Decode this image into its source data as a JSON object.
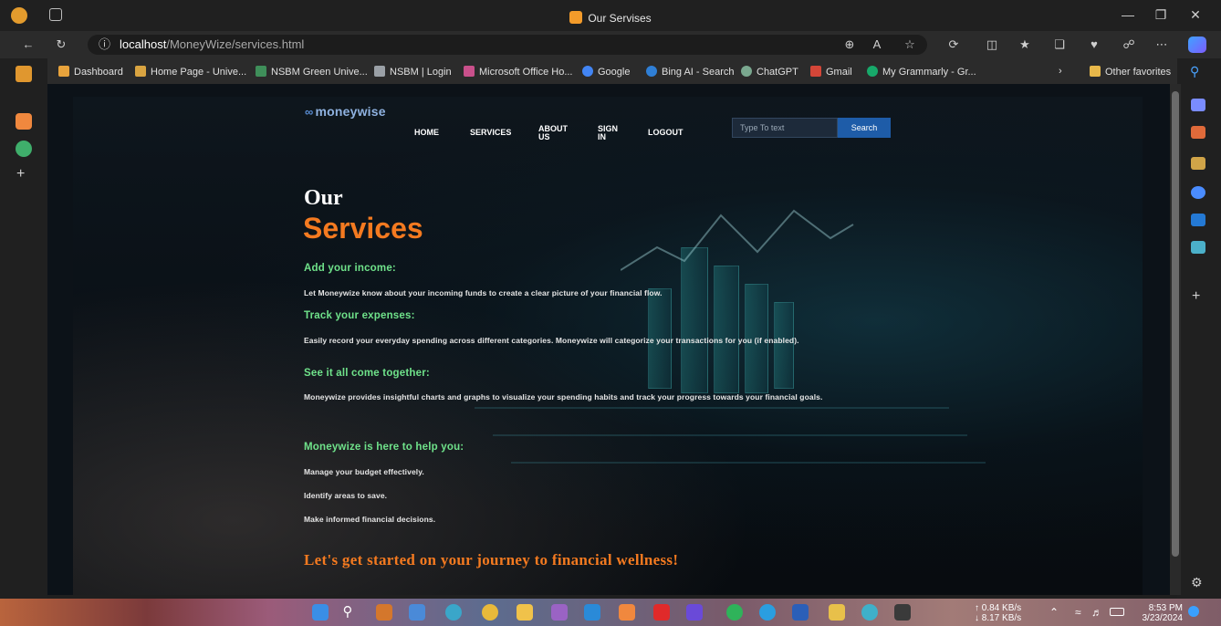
{
  "browser": {
    "tab_title": "Our Servises",
    "url_host": "localhost",
    "url_path": "/MoneyWize/services.html",
    "favorites": [
      {
        "label": "Dashboard",
        "color": "#e8a33c"
      },
      {
        "label": "Home Page - Unive...",
        "color": "#d9a441"
      },
      {
        "label": "NSBM Green Unive...",
        "color": "#3f8f5a"
      },
      {
        "label": "NSBM | Login",
        "color": "#9aa0a6"
      },
      {
        "label": "Microsoft Office Ho...",
        "color": "#c9508b"
      },
      {
        "label": "Google",
        "color": "#4285f4"
      },
      {
        "label": "Bing AI - Search",
        "color": "#2f7fd6"
      },
      {
        "label": "ChatGPT",
        "color": "#7aa88f"
      },
      {
        "label": "Gmail",
        "color": "#d44638"
      },
      {
        "label": "My Grammarly - Gr...",
        "color": "#17a96a"
      }
    ],
    "other_favorites": "Other favorites"
  },
  "site": {
    "logo_mark": "∞",
    "logo_text": "moneywise",
    "nav": {
      "home": "HOME",
      "services": "SERVICES",
      "about": "ABOUT US",
      "signin": "SIGN IN",
      "logout": "LOGOUT"
    },
    "search": {
      "placeholder": "Type To text",
      "button": "Search"
    }
  },
  "content": {
    "heading_small": "Our",
    "heading_large": "Services",
    "sections": [
      {
        "title": "Add your income:",
        "text": "Let Moneywize know about your incoming funds to create a clear picture of your financial flow."
      },
      {
        "title": "Track your expenses:",
        "text": "Easily record your everyday spending across different categories. Moneywize will categorize your transactions for you (if enabled)."
      },
      {
        "title": "See it all come together:",
        "text": "Moneywize provides insightful charts and graphs to visualize your spending habits and track your progress towards your financial goals."
      }
    ],
    "help_title": "Moneywize is here to help you:",
    "help_items": [
      "Manage your budget effectively.",
      "Identify areas to save.",
      "Make informed financial decisions."
    ],
    "cta": "Let's get started on your journey to financial wellness!"
  },
  "taskbar": {
    "net_up": "↑ 0.84 KB/s",
    "net_down": "↓ 8.17 KB/s",
    "time": "8:53 PM",
    "date": "3/23/2024"
  }
}
